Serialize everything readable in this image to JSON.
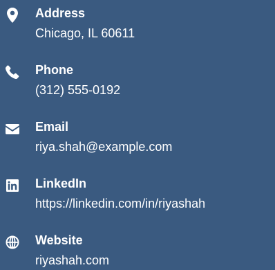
{
  "contact": {
    "items": [
      {
        "icon": "map-pin-icon",
        "label": "Address",
        "value": "Chicago, IL 60611"
      },
      {
        "icon": "phone-icon",
        "label": "Phone",
        "value": "(312) 555-0192"
      },
      {
        "icon": "envelope-icon",
        "label": "Email",
        "value": "riya.shah@example.com"
      },
      {
        "icon": "linkedin-icon",
        "label": "LinkedIn",
        "value": "https://linkedin.com/in/riyashah"
      },
      {
        "icon": "globe-icon",
        "label": "Website",
        "value": "riyashah.com"
      }
    ]
  },
  "colors": {
    "background": "#3a5a80",
    "text": "#ffffff"
  }
}
